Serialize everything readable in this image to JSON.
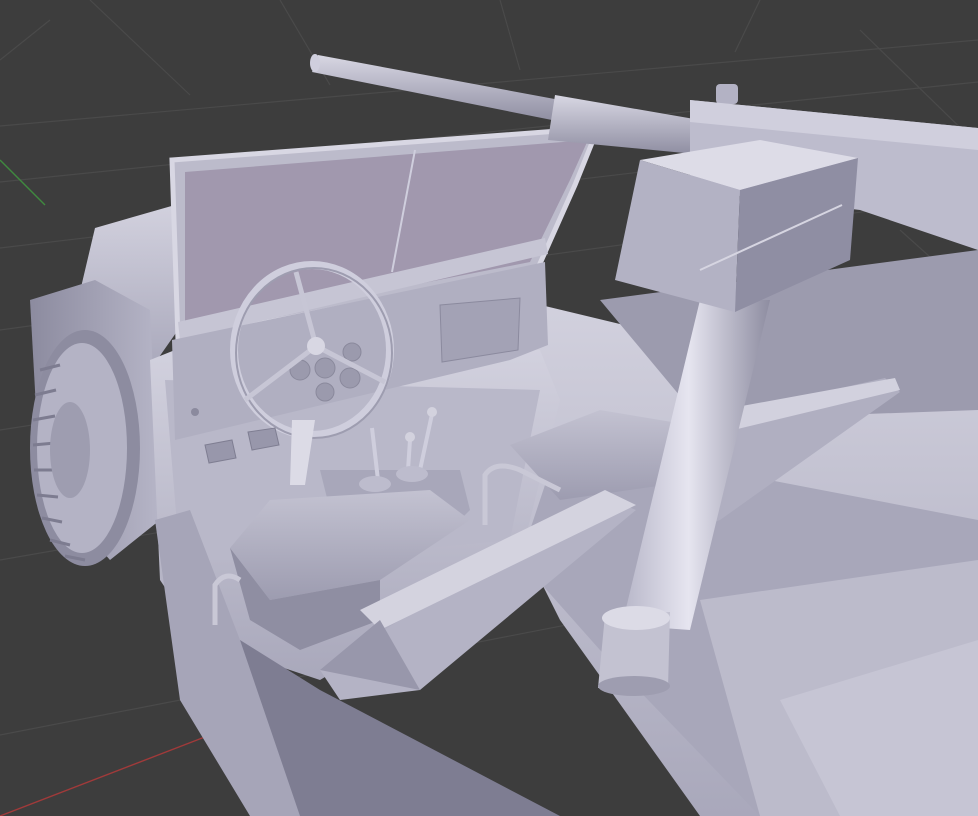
{
  "viewport": {
    "background_color": "#3d3d3d",
    "grid_color": "#4a4a4a",
    "x_axis_color": "#a03a3a",
    "y_axis_color": "#3f8a3f",
    "view": "perspective"
  },
  "model": {
    "subject": "military-jeep-with-mounted-gun",
    "shading": "solid",
    "base_color": "#c9c8d6",
    "shadow_color": "#8f8ea2",
    "highlight_color": "#e3e2ee",
    "glass_color": "#a198ae"
  }
}
